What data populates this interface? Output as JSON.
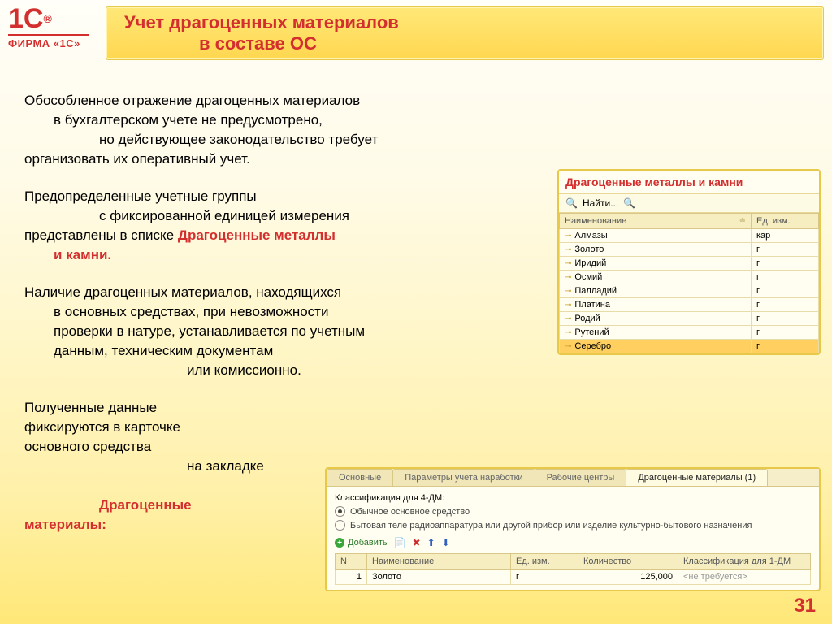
{
  "logo": {
    "mark": "1C",
    "reg": "®",
    "sub": "ФИРМА «1С»"
  },
  "title": {
    "line1": "Учет драгоценных материалов",
    "line2": "в составе ОС"
  },
  "body": {
    "p1": {
      "l1": "Обособленное отражение драгоценных материалов",
      "l2": "в бухгалтерском учете не предусмотрено,",
      "l3": "но действующее законодательство требует",
      "l4": "организовать их оперативный учет."
    },
    "p2": {
      "l1": "Предопределенные учетные группы",
      "l2": "с фиксированной единицей измерения",
      "l3a": "представлены в списке",
      "hl1": "Драгоценные металлы",
      "hl2": "и камни."
    },
    "p3": {
      "l1": "Наличие драгоценных материалов, находящихся",
      "l2": "в основных средствах, при невозможности",
      "l3": "проверки в натуре, устанавливается по учетным",
      "l4": "данным, техническим документам",
      "l5": "или комиссионно."
    },
    "p4": {
      "l1": "Полученные данные",
      "l2": "фиксируются в карточке",
      "l3": "основного средства",
      "l4": "на закладке",
      "hl1": "Драгоценные",
      "hl2": "материалы:"
    }
  },
  "panel_metals": {
    "title": "Драгоценные металлы и камни",
    "find": "Найти...",
    "col_name": "Наименование",
    "col_unit": "Ед. изм.",
    "rows": [
      {
        "name": "Алмазы",
        "unit": "кар"
      },
      {
        "name": "Золото",
        "unit": "г"
      },
      {
        "name": "Иридий",
        "unit": "г"
      },
      {
        "name": "Осмий",
        "unit": "г"
      },
      {
        "name": "Палладий",
        "unit": "г"
      },
      {
        "name": "Платина",
        "unit": "г"
      },
      {
        "name": "Родий",
        "unit": "г"
      },
      {
        "name": "Рутений",
        "unit": "г"
      },
      {
        "name": "Серебро",
        "unit": "г"
      }
    ]
  },
  "panel_card": {
    "tabs": [
      "Основные",
      "Параметры учета наработки",
      "Рабочие центры",
      "Драгоценные материалы (1)"
    ],
    "class_label": "Классификация для 4-ДМ:",
    "radio1": "Обычное основное средство",
    "radio2": "Бытовая теле радиоаппаратура или другой прибор или изделие культурно-бытового назначения",
    "add": "Добавить",
    "cols": [
      "N",
      "Наименование",
      "Ед. изм.",
      "Количество",
      "Классификация для 1-ДМ"
    ],
    "row": {
      "n": "1",
      "name": "Золото",
      "unit": "г",
      "qty": "125,000",
      "class": "<не требуется>"
    }
  },
  "page": "31"
}
